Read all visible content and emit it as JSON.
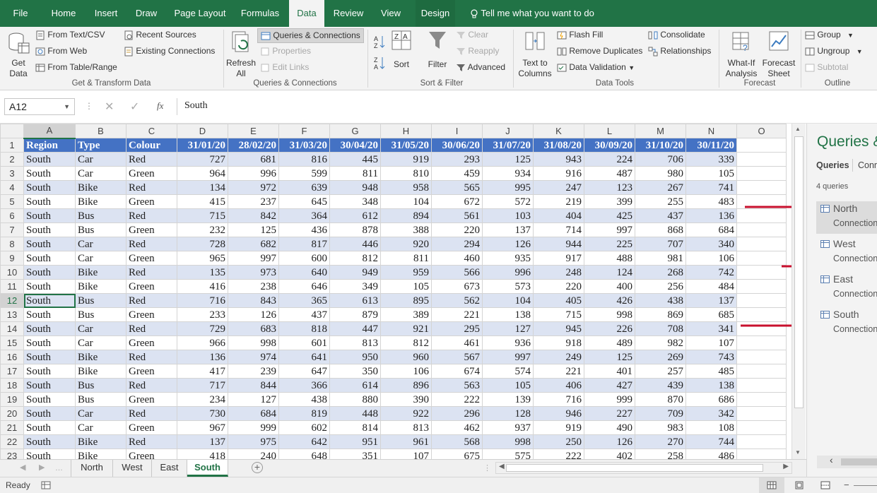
{
  "tabs": [
    "File",
    "Home",
    "Insert",
    "Draw",
    "Page Layout",
    "Formulas",
    "Data",
    "Review",
    "View",
    "Design"
  ],
  "tell_me": "Tell me what you want to do",
  "ribbon": {
    "get_data": "Get Data",
    "from_text": "From Text/CSV",
    "from_web": "From Web",
    "from_table": "From Table/Range",
    "recent_sources": "Recent Sources",
    "existing_connections": "Existing Connections",
    "group_get_transform": "Get & Transform Data",
    "refresh_all": "Refresh All",
    "queries_connections": "Queries & Connections",
    "properties": "Properties",
    "edit_links": "Edit Links",
    "group_queries": "Queries & Connections",
    "sort": "Sort",
    "filter": "Filter",
    "clear": "Clear",
    "reapply": "Reapply",
    "advanced": "Advanced",
    "group_sort_filter": "Sort & Filter",
    "text_to_columns": "Text to Columns",
    "flash_fill": "Flash Fill",
    "remove_duplicates": "Remove Duplicates",
    "data_validation": "Data Validation",
    "consolidate": "Consolidate",
    "relationships": "Relationships",
    "group_data_tools": "Data Tools",
    "what_if": "What-If Analysis",
    "forecast_sheet": "Forecast Sheet",
    "group_forecast": "Forecast",
    "group": "Group",
    "ungroup": "Ungroup",
    "subtotal": "Subtotal",
    "group_outline": "Outline"
  },
  "formula_bar": {
    "name_box": "A12",
    "fx": "fx",
    "value": "South"
  },
  "columns": [
    "A",
    "B",
    "C",
    "D",
    "E",
    "F",
    "G",
    "H",
    "I",
    "J",
    "K",
    "L",
    "M",
    "N",
    "O"
  ],
  "header_row": [
    "Region",
    "Type",
    "Colour",
    "31/01/20",
    "28/02/20",
    "31/03/20",
    "30/04/20",
    "31/05/20",
    "30/06/20",
    "31/07/20",
    "31/08/20",
    "30/09/20",
    "31/10/20",
    "30/11/20"
  ],
  "rows": [
    [
      "South",
      "Car",
      "Red",
      727,
      681,
      816,
      445,
      919,
      293,
      125,
      943,
      224,
      706,
      339
    ],
    [
      "South",
      "Car",
      "Green",
      964,
      996,
      599,
      811,
      810,
      459,
      934,
      916,
      487,
      980,
      105
    ],
    [
      "South",
      "Bike",
      "Red",
      134,
      972,
      639,
      948,
      958,
      565,
      995,
      247,
      123,
      267,
      741
    ],
    [
      "South",
      "Bike",
      "Green",
      415,
      237,
      645,
      348,
      104,
      672,
      572,
      219,
      399,
      255,
      483
    ],
    [
      "South",
      "Bus",
      "Red",
      715,
      842,
      364,
      612,
      894,
      561,
      103,
      404,
      425,
      437,
      136
    ],
    [
      "South",
      "Bus",
      "Green",
      232,
      125,
      436,
      878,
      388,
      220,
      137,
      714,
      997,
      868,
      684
    ],
    [
      "South",
      "Car",
      "Red",
      728,
      682,
      817,
      446,
      920,
      294,
      126,
      944,
      225,
      707,
      340
    ],
    [
      "South",
      "Car",
      "Green",
      965,
      997,
      600,
      812,
      811,
      460,
      935,
      917,
      488,
      981,
      106
    ],
    [
      "South",
      "Bike",
      "Red",
      135,
      973,
      640,
      949,
      959,
      566,
      996,
      248,
      124,
      268,
      742
    ],
    [
      "South",
      "Bike",
      "Green",
      416,
      238,
      646,
      349,
      105,
      673,
      573,
      220,
      400,
      256,
      484
    ],
    [
      "South",
      "Bus",
      "Red",
      716,
      843,
      365,
      613,
      895,
      562,
      104,
      405,
      426,
      438,
      137
    ],
    [
      "South",
      "Bus",
      "Green",
      233,
      126,
      437,
      879,
      389,
      221,
      138,
      715,
      998,
      869,
      685
    ],
    [
      "South",
      "Car",
      "Red",
      729,
      683,
      818,
      447,
      921,
      295,
      127,
      945,
      226,
      708,
      341
    ],
    [
      "South",
      "Car",
      "Green",
      966,
      998,
      601,
      813,
      812,
      461,
      936,
      918,
      489,
      982,
      107
    ],
    [
      "South",
      "Bike",
      "Red",
      136,
      974,
      641,
      950,
      960,
      567,
      997,
      249,
      125,
      269,
      743
    ],
    [
      "South",
      "Bike",
      "Green",
      417,
      239,
      647,
      350,
      106,
      674,
      574,
      221,
      401,
      257,
      485
    ],
    [
      "South",
      "Bus",
      "Red",
      717,
      844,
      366,
      614,
      896,
      563,
      105,
      406,
      427,
      439,
      138
    ],
    [
      "South",
      "Bus",
      "Green",
      234,
      127,
      438,
      880,
      390,
      222,
      139,
      716,
      999,
      870,
      686
    ],
    [
      "South",
      "Car",
      "Red",
      730,
      684,
      819,
      448,
      922,
      296,
      128,
      946,
      227,
      709,
      342
    ],
    [
      "South",
      "Car",
      "Green",
      967,
      999,
      602,
      814,
      813,
      462,
      937,
      919,
      490,
      983,
      108
    ],
    [
      "South",
      "Bike",
      "Red",
      137,
      975,
      642,
      951,
      961,
      568,
      998,
      250,
      126,
      270,
      744
    ],
    [
      "South",
      "Bike",
      "Green",
      418,
      240,
      648,
      351,
      107,
      675,
      575,
      222,
      402,
      258,
      486
    ]
  ],
  "pane": {
    "title": "Queries &",
    "tab_queries": "Queries",
    "tab_conn": "Conn",
    "count": "4 queries",
    "items": [
      {
        "name": "North",
        "sub": "Connection"
      },
      {
        "name": "West",
        "sub": "Connection"
      },
      {
        "name": "East",
        "sub": "Connection"
      },
      {
        "name": "South",
        "sub": "Connection"
      }
    ]
  },
  "sheets": [
    "North",
    "West",
    "East",
    "South"
  ],
  "status": "Ready",
  "colors": {
    "accent": "#217346",
    "header_fill": "#4472c4",
    "band": "#dce3f2",
    "bracket": "#c8102e"
  }
}
